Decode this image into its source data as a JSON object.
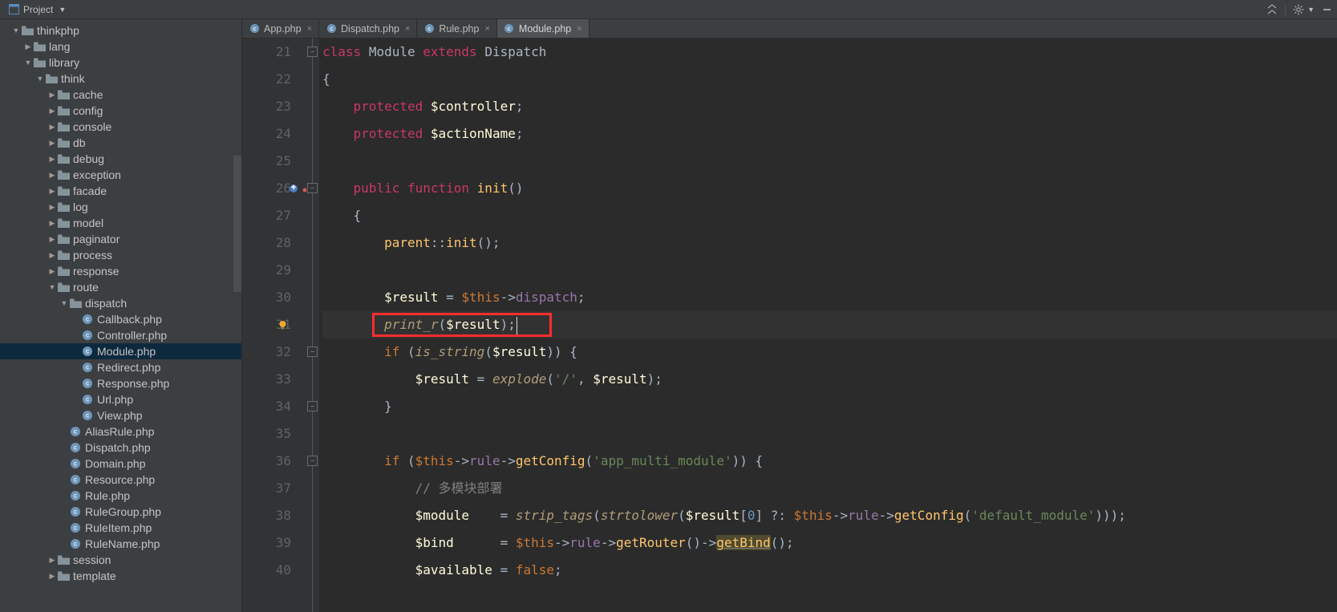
{
  "toolbar": {
    "project_label": "Project"
  },
  "tabs": [
    {
      "label": "App.php",
      "active": false
    },
    {
      "label": "Dispatch.php",
      "active": false
    },
    {
      "label": "Rule.php",
      "active": false
    },
    {
      "label": "Module.php",
      "active": true
    }
  ],
  "tree": [
    {
      "depth": 0,
      "arrow": "down",
      "icon": "folder",
      "label": "thinkphp"
    },
    {
      "depth": 1,
      "arrow": "right",
      "icon": "folder",
      "label": "lang"
    },
    {
      "depth": 1,
      "arrow": "down",
      "icon": "folder",
      "label": "library"
    },
    {
      "depth": 2,
      "arrow": "down",
      "icon": "folder",
      "label": "think"
    },
    {
      "depth": 3,
      "arrow": "right",
      "icon": "folder",
      "label": "cache"
    },
    {
      "depth": 3,
      "arrow": "right",
      "icon": "folder",
      "label": "config"
    },
    {
      "depth": 3,
      "arrow": "right",
      "icon": "folder",
      "label": "console"
    },
    {
      "depth": 3,
      "arrow": "right",
      "icon": "folder",
      "label": "db"
    },
    {
      "depth": 3,
      "arrow": "right",
      "icon": "folder",
      "label": "debug"
    },
    {
      "depth": 3,
      "arrow": "right",
      "icon": "folder",
      "label": "exception"
    },
    {
      "depth": 3,
      "arrow": "right",
      "icon": "folder",
      "label": "facade"
    },
    {
      "depth": 3,
      "arrow": "right",
      "icon": "folder",
      "label": "log"
    },
    {
      "depth": 3,
      "arrow": "right",
      "icon": "folder",
      "label": "model"
    },
    {
      "depth": 3,
      "arrow": "right",
      "icon": "folder",
      "label": "paginator"
    },
    {
      "depth": 3,
      "arrow": "right",
      "icon": "folder",
      "label": "process"
    },
    {
      "depth": 3,
      "arrow": "right",
      "icon": "folder",
      "label": "response"
    },
    {
      "depth": 3,
      "arrow": "down",
      "icon": "folder",
      "label": "route"
    },
    {
      "depth": 4,
      "arrow": "down",
      "icon": "folder",
      "label": "dispatch"
    },
    {
      "depth": 5,
      "arrow": "none",
      "icon": "php",
      "label": "Callback.php"
    },
    {
      "depth": 5,
      "arrow": "none",
      "icon": "php",
      "label": "Controller.php"
    },
    {
      "depth": 5,
      "arrow": "none",
      "icon": "php",
      "label": "Module.php",
      "selected": true
    },
    {
      "depth": 5,
      "arrow": "none",
      "icon": "php",
      "label": "Redirect.php"
    },
    {
      "depth": 5,
      "arrow": "none",
      "icon": "php",
      "label": "Response.php"
    },
    {
      "depth": 5,
      "arrow": "none",
      "icon": "php",
      "label": "Url.php"
    },
    {
      "depth": 5,
      "arrow": "none",
      "icon": "php",
      "label": "View.php"
    },
    {
      "depth": 4,
      "arrow": "none",
      "icon": "php",
      "label": "AliasRule.php"
    },
    {
      "depth": 4,
      "arrow": "none",
      "icon": "php",
      "label": "Dispatch.php"
    },
    {
      "depth": 4,
      "arrow": "none",
      "icon": "php",
      "label": "Domain.php"
    },
    {
      "depth": 4,
      "arrow": "none",
      "icon": "php",
      "label": "Resource.php"
    },
    {
      "depth": 4,
      "arrow": "none",
      "icon": "php",
      "label": "Rule.php"
    },
    {
      "depth": 4,
      "arrow": "none",
      "icon": "php",
      "label": "RuleGroup.php"
    },
    {
      "depth": 4,
      "arrow": "none",
      "icon": "php",
      "label": "RuleItem.php"
    },
    {
      "depth": 4,
      "arrow": "none",
      "icon": "php",
      "label": "RuleName.php"
    },
    {
      "depth": 3,
      "arrow": "right",
      "icon": "folder",
      "label": "session"
    },
    {
      "depth": 3,
      "arrow": "right",
      "icon": "folder",
      "label": "template"
    }
  ],
  "gutter": {
    "start": 21,
    "end": 40,
    "bulb_line": 31,
    "override_line": 26
  },
  "code_lines": [
    {
      "n": 21,
      "html": "<span class='pink'>class</span> <span class='cls'>Module</span> <span class='pink'>extends</span> <span class='cls'>Dispatch</span>"
    },
    {
      "n": 22,
      "html": "<span class='sym'>{</span>"
    },
    {
      "n": 23,
      "html": "    <span class='pink'>protected</span> <span class='var'>$controller</span><span class='sym'>;</span>"
    },
    {
      "n": 24,
      "html": "    <span class='pink'>protected</span> <span class='var'>$actionName</span><span class='sym'>;</span>"
    },
    {
      "n": 25,
      "html": ""
    },
    {
      "n": 26,
      "html": "    <span class='pink'>public</span> <span class='pink'>function</span> <span class='fn'>init</span><span class='sym'>()</span>"
    },
    {
      "n": 27,
      "html": "    <span class='sym'>{</span>"
    },
    {
      "n": 28,
      "html": "        <span class='fn'>parent</span><span class='sym'>::</span><span class='call'>init</span><span class='sym'>();</span>"
    },
    {
      "n": 29,
      "html": ""
    },
    {
      "n": 30,
      "html": "        <span class='var'>$result</span> <span class='op'>=</span> <span class='varthis'>$this</span><span class='op'>-&gt;</span><span class='prop'>dispatch</span><span class='sym'>;</span>"
    },
    {
      "n": 31,
      "html": "        <span class='fni'>print_r</span><span class='sym'>(</span><span class='var'>$result</span><span class='sym'>);</span><span class='caret'></span>",
      "current": true
    },
    {
      "n": 32,
      "html": "        <span class='kw'>if</span> <span class='sym'>(</span><span class='fni'>is_string</span><span class='sym'>(</span><span class='var'>$result</span><span class='sym'>)) {</span>"
    },
    {
      "n": 33,
      "html": "            <span class='var'>$result</span> <span class='op'>=</span> <span class='fni'>explode</span><span class='sym'>(</span><span class='str'>'/'</span><span class='sym'>, </span><span class='var'>$result</span><span class='sym'>);</span>"
    },
    {
      "n": 34,
      "html": "        <span class='sym'>}</span>"
    },
    {
      "n": 35,
      "html": ""
    },
    {
      "n": 36,
      "html": "        <span class='kw'>if</span> <span class='sym'>(</span><span class='varthis'>$this</span><span class='op'>-&gt;</span><span class='prop'>rule</span><span class='op'>-&gt;</span><span class='call'>getConfig</span><span class='sym'>(</span><span class='str'>'app_multi_module'</span><span class='sym'>)) {</span>"
    },
    {
      "n": 37,
      "html": "            <span class='cmt'>// 多模块部署</span>"
    },
    {
      "n": 38,
      "html": "            <span class='var'>$module</span>    <span class='op'>=</span> <span class='fni'>strip_tags</span><span class='sym'>(</span><span class='fni'>strtolower</span><span class='sym'>(</span><span class='var'>$result</span><span class='sym'>[</span><span class='num'>0</span><span class='sym'>] ?: </span><span class='varthis'>$this</span><span class='op'>-&gt;</span><span class='prop'>rule</span><span class='op'>-&gt;</span><span class='call'>getConfig</span><span class='sym'>(</span><span class='str'>'default_module'</span><span class='sym'>)));</span>"
    },
    {
      "n": 39,
      "html": "            <span class='var'>$bind</span>      <span class='op'>=</span> <span class='varthis'>$this</span><span class='op'>-&gt;</span><span class='prop'>rule</span><span class='op'>-&gt;</span><span class='call'>getRouter</span><span class='sym'>()-&gt;</span><span class='call warn-under under'>getBind</span><span class='sym'>();</span>"
    },
    {
      "n": 40,
      "html": "            <span class='var'>$available</span> <span class='op'>=</span> <span class='bool'>false</span><span class='sym'>;</span>"
    }
  ],
  "highlight_box": {
    "line": 31
  }
}
